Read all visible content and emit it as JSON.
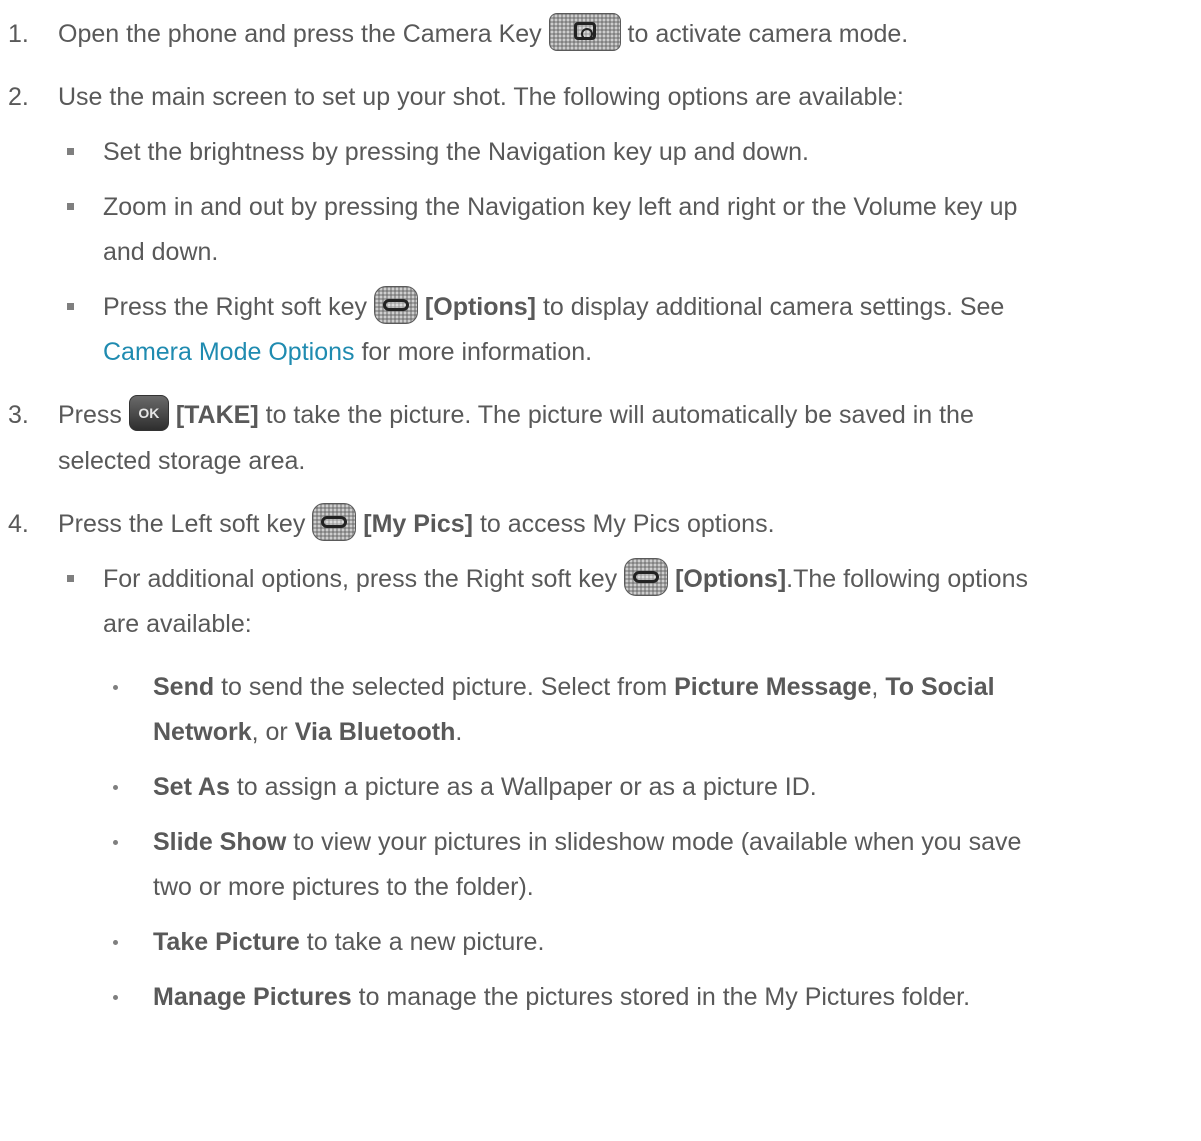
{
  "steps": [
    {
      "number": "1.",
      "pre": "Open the phone and press the Camera Key",
      "post": " to activate camera mode."
    },
    {
      "number": "2.",
      "text": "Use the main screen to set up your shot. The following options are available:",
      "bullets": [
        {
          "text": "Set the brightness by pressing the Navigation key up and down."
        },
        {
          "line1": "Zoom in and out by pressing the Navigation key left and right or the Volume key up",
          "line2": "and down."
        },
        {
          "pre": "Press the Right soft key",
          "bold": "[Options]",
          "post": " to display additional camera settings. See",
          "link": "Camera Mode Options",
          "post2": " for more information."
        }
      ]
    },
    {
      "number": "3.",
      "pre": "Press",
      "bold": "[TAKE]",
      "post": " to take the picture. The picture will automatically be saved in the",
      "line2": "selected storage area.",
      "key_label": "OK"
    },
    {
      "number": "4.",
      "pre": "Press the Left soft key",
      "bold": "[My Pics]",
      "post": " to access My Pics options.",
      "bullet": {
        "pre": "For additional options, press the Right soft key",
        "bold": "[Options]",
        "post": ".The following options",
        "line2": "are available:"
      },
      "subitems": [
        {
          "b1": "Send",
          "t1": " to send the selected picture. Select from ",
          "b2": "Picture Message",
          "t2": ", ",
          "b3": "To Social",
          "b4": "Network",
          "t3": ", or ",
          "b5": "Via Bluetooth",
          "t4": "."
        },
        {
          "bold": "Set As",
          "text": " to assign a picture as a Wallpaper or as a picture ID."
        },
        {
          "bold": "Slide Show",
          "text": " to view your pictures in slideshow mode (available when you save",
          "line2": "two or more pictures to the folder)."
        },
        {
          "bold": "Take Picture",
          "text": " to take a new picture."
        },
        {
          "bold": "Manage Pictures",
          "text": " to manage the pictures stored in the My Pictures folder."
        }
      ]
    }
  ],
  "icons": {
    "camera_key": "camera-key-icon",
    "soft_key": "soft-key-icon",
    "ok_key": "ok-key-icon"
  },
  "colors": {
    "text": "#595959",
    "link": "#1f8bb0",
    "bullet": "#7f7f7f"
  }
}
